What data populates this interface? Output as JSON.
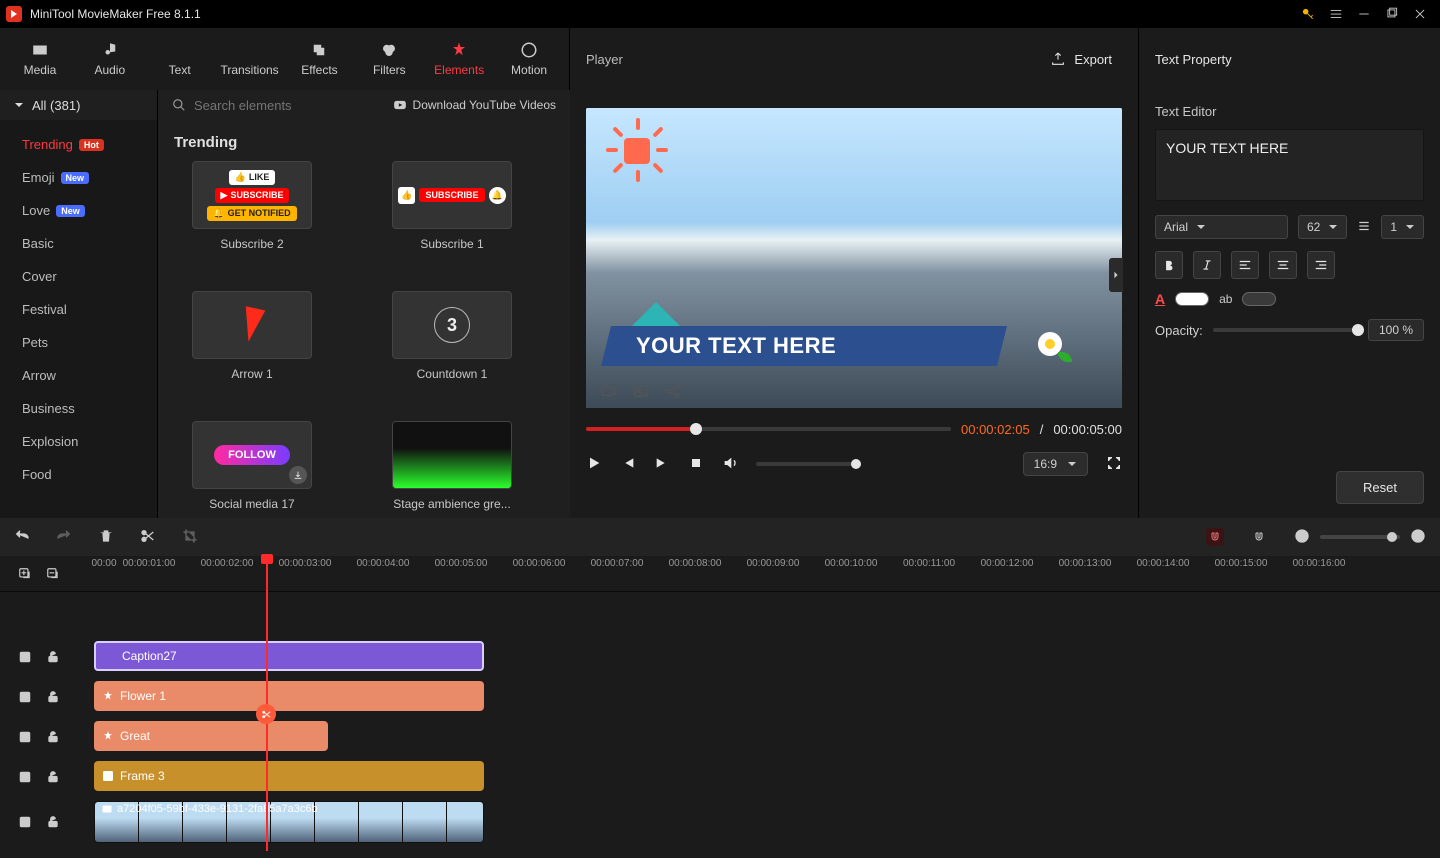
{
  "app": {
    "title": "MiniTool MovieMaker Free 8.1.1"
  },
  "ribbon": {
    "tabs": [
      {
        "label": "Media"
      },
      {
        "label": "Audio"
      },
      {
        "label": "Text"
      },
      {
        "label": "Transitions"
      },
      {
        "label": "Effects"
      },
      {
        "label": "Filters"
      },
      {
        "label": "Elements"
      },
      {
        "label": "Motion"
      }
    ],
    "active_index": 6,
    "player_label": "Player",
    "export_label": "Export",
    "prop_title": "Text Property"
  },
  "categories": {
    "all_label": "All (381)",
    "items": [
      {
        "label": "Trending",
        "badge": "Hot"
      },
      {
        "label": "Emoji",
        "badge": "New"
      },
      {
        "label": "Love",
        "badge": "New"
      },
      {
        "label": "Basic"
      },
      {
        "label": "Cover"
      },
      {
        "label": "Festival"
      },
      {
        "label": "Pets"
      },
      {
        "label": "Arrow"
      },
      {
        "label": "Business"
      },
      {
        "label": "Explosion"
      },
      {
        "label": "Food"
      }
    ],
    "active_index": 0
  },
  "browser": {
    "search_placeholder": "Search elements",
    "download_label": "Download YouTube Videos",
    "heading": "Trending",
    "thumbs": [
      {
        "label": "Subscribe 2"
      },
      {
        "label": "Subscribe 1"
      },
      {
        "label": "Arrow 1"
      },
      {
        "label": "Countdown 1"
      },
      {
        "label": "Social media 17"
      },
      {
        "label": "Stage ambience gre..."
      }
    ],
    "sub_pills": {
      "like": "LIKE",
      "sub": "SUBSCRIBE",
      "notify": "GET NOTIFIED"
    },
    "countdown_val": "3",
    "follow_label": "FOLLOW"
  },
  "player": {
    "overlay_text": "YOUR TEXT HERE",
    "time_current": "00:00:02:05",
    "time_total": "00:00:05:00",
    "time_sep": " / ",
    "aspect": "16:9"
  },
  "prop": {
    "editor_label": "Text Editor",
    "text_value": "YOUR TEXT HERE",
    "font_family": "Arial",
    "font_size": "62",
    "line_height": "1",
    "opacity_label": "Opacity:",
    "opacity_value": "100 %",
    "reset_label": "Reset",
    "font_color": "#ffffff",
    "highlight_color": "#3a3a3a"
  },
  "timeline": {
    "ruler_start": "00:00",
    "ticks": [
      "00:00:01:00",
      "00:00:02:00",
      "00:00:03:00",
      "00:00:04:00",
      "00:00:05:00",
      "00:00:06:00",
      "00:00:07:00",
      "00:00:08:00",
      "00:00:09:00",
      "00:00:10:00",
      "00:00:11:00",
      "00:00:12:00",
      "00:00:13:00",
      "00:00:14:00",
      "00:00:15:00",
      "00:00:16:00"
    ],
    "clips": {
      "caption": "Caption27",
      "flower": "Flower 1",
      "great": "Great",
      "frame": "Frame 3",
      "video": "a7204f05-59bf-433e-9131-2fa85a7a3c6b"
    }
  }
}
